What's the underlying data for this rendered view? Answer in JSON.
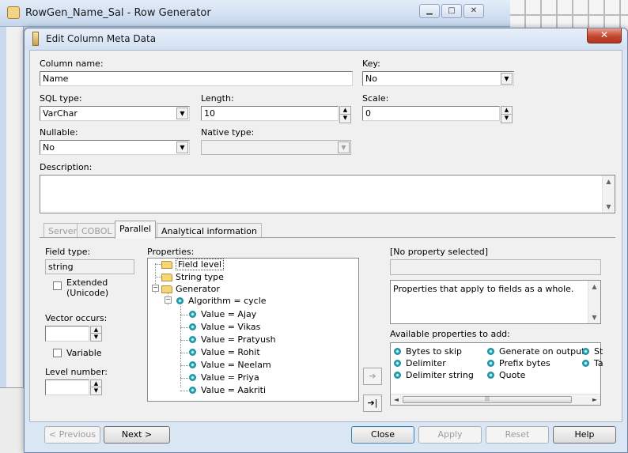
{
  "background_window": {
    "title": "RowGen_Name_Sal - Row Generator",
    "buttons": {
      "minimize": "▁",
      "maximize": "□",
      "close": "✕"
    }
  },
  "dialog": {
    "title": "Edit Column Meta Data",
    "close_glyph": "✕"
  },
  "form": {
    "column_name": {
      "label": "Column name:",
      "value": "Name"
    },
    "key": {
      "label": "Key:",
      "value": "No"
    },
    "sql_type": {
      "label": "SQL type:",
      "value": "VarChar"
    },
    "length": {
      "label": "Length:",
      "value": "10"
    },
    "scale": {
      "label": "Scale:",
      "value": "0"
    },
    "nullable": {
      "label": "Nullable:",
      "value": "No"
    },
    "native_type": {
      "label": "Native type:",
      "value": ""
    },
    "description": {
      "label": "Description:",
      "value": ""
    }
  },
  "tabs": [
    {
      "label": "Server",
      "state": "disabled"
    },
    {
      "label": "COBOL",
      "state": "disabled"
    },
    {
      "label": "Parallel",
      "state": "selected"
    },
    {
      "label": "Analytical information",
      "state": "normal"
    }
  ],
  "parallel": {
    "field_type": {
      "label": "Field type:",
      "value": "string"
    },
    "extended": {
      "label_line1": "Extended",
      "label_line2": "(Unicode)",
      "checked": false
    },
    "vector_occurs": {
      "label": "Vector occurs:",
      "value": ""
    },
    "variable": {
      "label": "Variable",
      "checked": false
    },
    "level_number": {
      "label": "Level number:",
      "value": ""
    },
    "properties_label": "Properties:",
    "tree": {
      "field_level": "Field level",
      "string_type": "String type",
      "generator": "Generator",
      "algorithm": "Algorithm = cycle",
      "values": [
        "Value = Ajay",
        "Value = Vikas",
        "Value = Pratyush",
        "Value = Rohit",
        "Value = Neelam",
        "Value = Priya",
        "Value = Aakriti"
      ],
      "expand_glyph": "+",
      "collapse_glyph": "−"
    },
    "selected_property_label": "[No property selected]",
    "selected_property_value": "",
    "property_help": "Properties that apply to fields as a whole.",
    "available_label": "Available properties to add:",
    "available": {
      "col1": [
        "Bytes to skip",
        "Delimiter",
        "Delimiter string"
      ],
      "col2": [
        "Generate on output",
        "Prefix bytes",
        "Quote"
      ],
      "col3": [
        "St",
        "Ta"
      ]
    },
    "add_arrow": "➔",
    "add_arrow2": "➔|"
  },
  "scroll_glyphs": {
    "up": "▲",
    "down": "▼",
    "left": "◄",
    "right": "►",
    "grip": "|||"
  },
  "buttons": {
    "previous": "< Previous",
    "next": "Next >",
    "close": "Close",
    "apply": "Apply",
    "reset": "Reset",
    "help": "Help"
  },
  "colors": {
    "dialog_frame": "#dae6f4",
    "client": "#f0f0f0",
    "close_red": "#c4472f"
  }
}
